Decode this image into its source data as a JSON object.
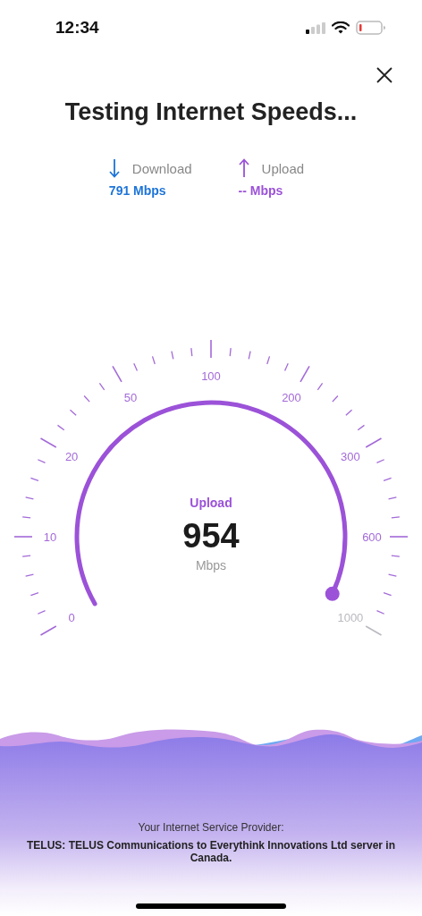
{
  "status_bar": {
    "time": "12:34"
  },
  "title": "Testing Internet Speeds...",
  "results": [
    {
      "kind": "download",
      "label": "Download",
      "value": "791 Mbps",
      "color": "#1d74d8"
    },
    {
      "kind": "upload",
      "label": "Upload",
      "value": "-- Mbps",
      "color": "#9b52d8"
    }
  ],
  "gauge": {
    "phase": "Upload",
    "reading": "954",
    "unit": "Mbps",
    "scale_labels": [
      "0",
      "10",
      "20",
      "50",
      "100",
      "200",
      "300",
      "600",
      "1000"
    ]
  },
  "footer": {
    "caption": "Your Internet Service Provider:",
    "provider": "TELUS: TELUS Communications to Everythink Innovations Ltd server in Canada."
  }
}
